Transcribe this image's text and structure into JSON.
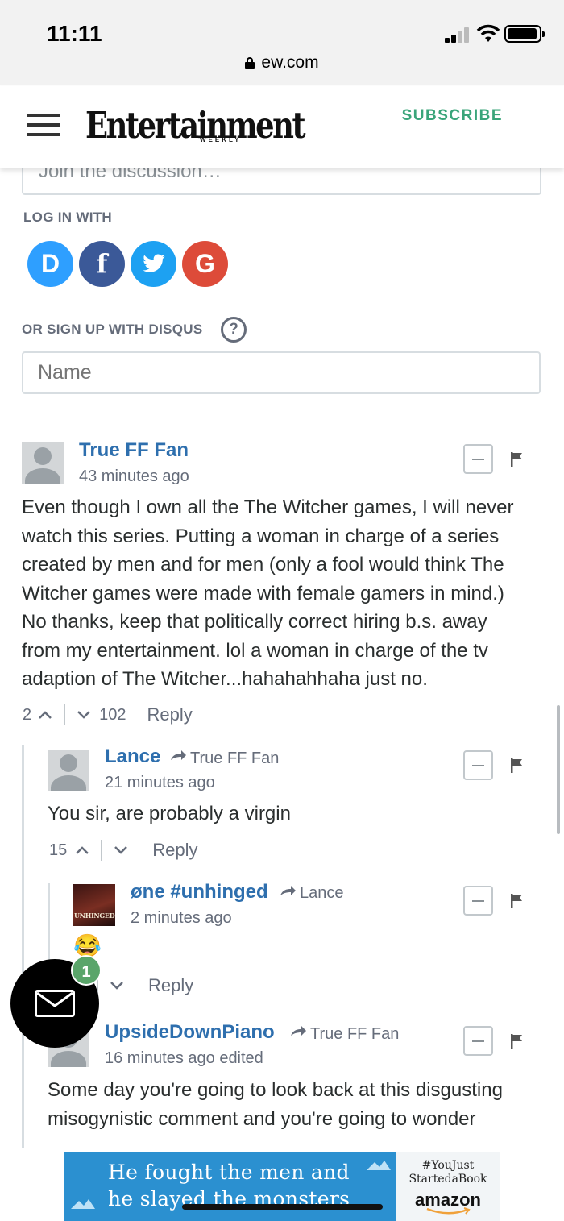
{
  "status": {
    "time": "11:11",
    "url": "ew.com"
  },
  "header": {
    "logo": "Entertainment",
    "logo_sub": "WEEKLY",
    "subscribe": "SUBSCRIBE"
  },
  "disqus": {
    "join_placeholder": "Join the discussion…",
    "login_label": "LOG IN WITH",
    "social": [
      {
        "name": "Disqus",
        "letter": "D",
        "color": "#2e9fff"
      },
      {
        "name": "Facebook",
        "letter": "f",
        "color": "#3b5998"
      },
      {
        "name": "Twitter",
        "letter": "t",
        "color": "#1da1f2"
      },
      {
        "name": "Google",
        "letter": "G",
        "color": "#dd4b39"
      }
    ],
    "signup_label": "OR SIGN UP WITH DISQUS",
    "help": "?",
    "name_placeholder": "Name"
  },
  "comments": [
    {
      "author": "True FF Fan",
      "time": "43 minutes ago",
      "lines": [
        "Even though I own all the The Witcher games, I will never",
        "watch this series. Putting a woman in charge of a series",
        "created by men and for men (only a fool would think The",
        "Witcher games were made with female gamers in mind.)",
        "No thanks, keep that politically correct hiring b.s. away",
        "from my entertainment. lol a woman in charge of the tv",
        "adaption of The Witcher...hahahahhaha just no."
      ],
      "upvotes": "2",
      "downvotes": "102",
      "reply": "Reply"
    },
    {
      "author": "Lance",
      "reply_to": "True FF Fan",
      "time": "21 minutes ago",
      "lines": [
        "You sir, are probably a virgin"
      ],
      "upvotes": "15",
      "reply": "Reply"
    },
    {
      "author": "øne #unhinged",
      "reply_to": "Lance",
      "time": "2 minutes ago",
      "avatar_text": "UNHINGED",
      "body": "😂",
      "reply": "Reply"
    },
    {
      "author": "UpsideDownPiano",
      "reply_to": "True FF Fan",
      "time": "16 minutes ago edited",
      "lines": [
        "Some day you're going to look back at this disgusting",
        "misogynistic comment and you're going to wonder"
      ]
    }
  ],
  "fab": {
    "badge": "1"
  },
  "ad": {
    "line1": "He fought the men and",
    "line2": "he slayed the monsters",
    "tag1": "#YouJust",
    "tag2": "StartedaBook",
    "brand": "amazon",
    "bg_color": "#2b90d0"
  }
}
